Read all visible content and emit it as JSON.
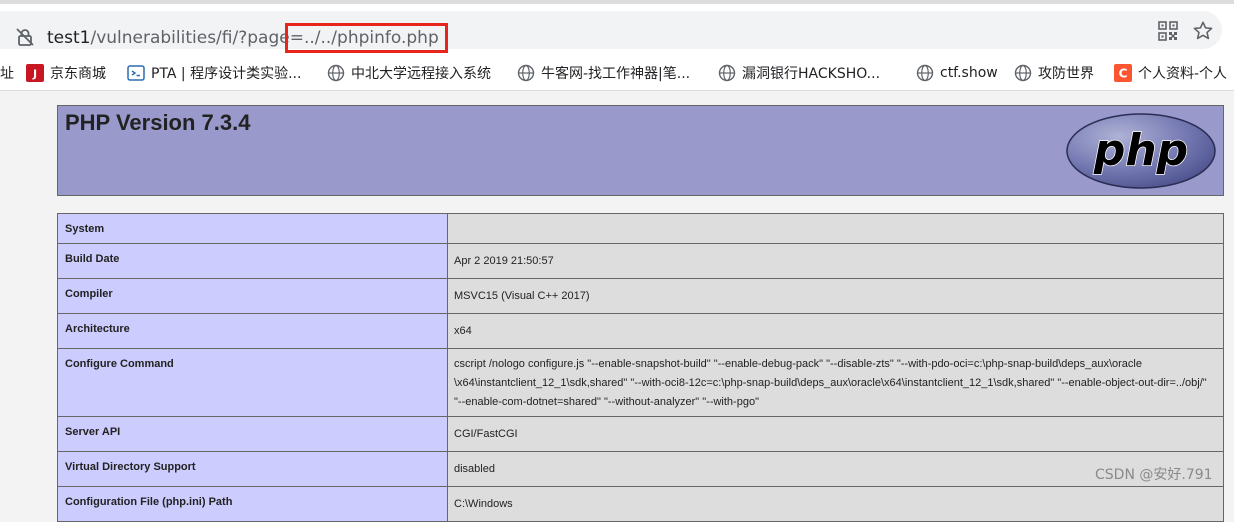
{
  "browser": {
    "url_host": "test1",
    "url_path": "/vulnerabilities/fi/?page",
    "url_highlight": "=../../phpinfo.php"
  },
  "bookmarks": [
    {
      "label": "址",
      "icon": "partial-icon"
    },
    {
      "label": "京东商城",
      "icon": "jd-icon"
    },
    {
      "label": "PTA | 程序设计类实验...",
      "icon": "pta-icon"
    },
    {
      "label": "中北大学远程接入系统",
      "icon": "globe-icon"
    },
    {
      "label": "牛客网-找工作神器|笔...",
      "icon": "globe-icon"
    },
    {
      "label": "漏洞银行HACKSHO...",
      "icon": "globe-icon"
    },
    {
      "label": "ctf.show",
      "icon": "globe-icon"
    },
    {
      "label": "攻防世界",
      "icon": "globe-icon"
    },
    {
      "label": "个人资料-个人",
      "icon": "csdn-icon"
    }
  ],
  "php": {
    "title": "PHP Version 7.3.4",
    "logo_text": "php"
  },
  "info_rows": [
    {
      "key": "System",
      "value": ""
    },
    {
      "key": "Build Date",
      "value": "Apr 2 2019 21:50:57"
    },
    {
      "key": "Compiler",
      "value": "MSVC15 (Visual C++ 2017)"
    },
    {
      "key": "Architecture",
      "value": "x64"
    },
    {
      "key": "Configure Command",
      "value": "cscript /nologo configure.js \"--enable-snapshot-build\" \"--enable-debug-pack\" \"--disable-zts\" \"--with-pdo-oci=c:\\php-snap-build\\deps_aux\\oracle \\x64\\instantclient_12_1\\sdk,shared\" \"--with-oci8-12c=c:\\php-snap-build\\deps_aux\\oracle\\x64\\instantclient_12_1\\sdk,shared\" \"--enable-object-out-dir=../obj/\" \"--enable-com-dotnet=shared\" \"--without-analyzer\" \"--with-pgo\""
    },
    {
      "key": "Server API",
      "value": "CGI/FastCGI"
    },
    {
      "key": "Virtual Directory Support",
      "value": "disabled"
    },
    {
      "key": "Configuration File (php.ini) Path",
      "value": "C:\\Windows"
    }
  ],
  "watermark": "CSDN @安好.791",
  "colors": {
    "php_header": "#9999cc",
    "key_cell": "#ccccff",
    "value_cell": "#dddddd",
    "url_highlight_box": "#e8251b"
  }
}
